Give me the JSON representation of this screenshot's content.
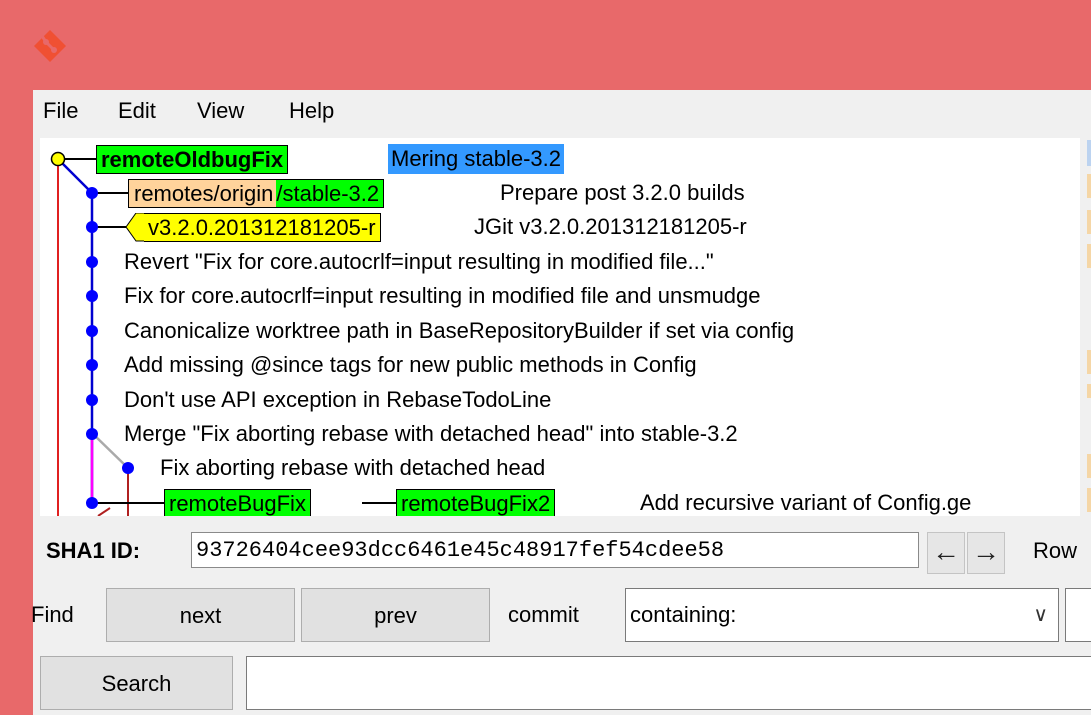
{
  "colors": {
    "titlebar": "#e8696a",
    "branch_local": "#00ff00",
    "branch_remote": "#ffd39b",
    "tag": "#ffff00",
    "head_highlight": "#3399ff"
  },
  "menu": [
    "File",
    "Edit",
    "View",
    "Help"
  ],
  "commits": [
    {
      "refs": [
        {
          "kind": "head",
          "label": "remoteOldbugFix"
        }
      ],
      "message": "Mering stable-3.2",
      "selected": true
    },
    {
      "refs": [
        {
          "kind": "remote",
          "prefix": "remotes/origin",
          "label": "/stable-3.2"
        }
      ],
      "message": "Prepare post 3.2.0 builds"
    },
    {
      "refs": [
        {
          "kind": "tag",
          "label": "v3.2.0.201312181205-r"
        }
      ],
      "message": "JGit v3.2.0.201312181205-r"
    },
    {
      "refs": [],
      "message": "Revert \"Fix for core.autocrlf=input resulting in modified file...\""
    },
    {
      "refs": [],
      "message": "Fix for core.autocrlf=input resulting in modified file and unsmudge"
    },
    {
      "refs": [],
      "message": "Canonicalize worktree path in BaseRepositoryBuilder if set via config"
    },
    {
      "refs": [],
      "message": "Add missing @since tags for new public methods in Config"
    },
    {
      "refs": [],
      "message": "Don't use API exception in RebaseTodoLine"
    },
    {
      "refs": [],
      "message": "Merge \"Fix aborting rebase with detached head\" into stable-3.2"
    },
    {
      "refs": [],
      "message": "Fix aborting rebase with detached head"
    },
    {
      "refs": [
        {
          "kind": "branch",
          "label": "remoteBugFix"
        },
        {
          "kind": "branch",
          "label": "remoteBugFix2"
        }
      ],
      "message": "Add recursive variant of Config.ge"
    }
  ],
  "sha": {
    "label": "SHA1 ID:",
    "value": "93726404cee93dcc6461e45c48917fef54cdee58",
    "back_icon": "arrow-left-icon",
    "forward_icon": "arrow-right-icon",
    "row_label": "Row"
  },
  "find": {
    "label": "Find",
    "next_label": "next",
    "prev_label": "prev",
    "commit_label": "commit",
    "mode_value": "containing:"
  },
  "search": {
    "button_label": "Search",
    "value": ""
  }
}
